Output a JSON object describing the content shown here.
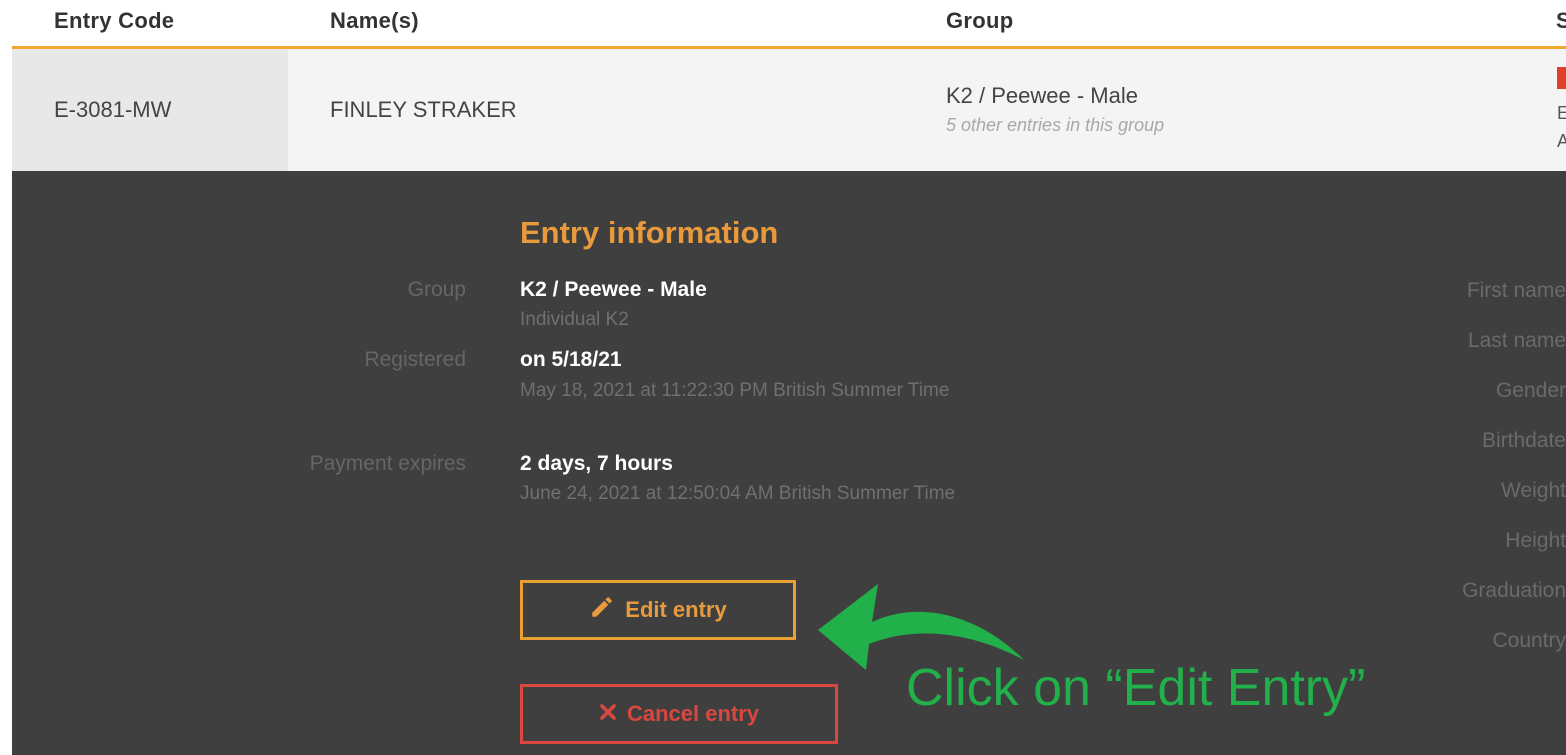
{
  "table": {
    "headers": [
      "Entry Code",
      "Name(s)",
      "Group",
      "S"
    ],
    "row": {
      "code": "E-3081-MW",
      "names": "FINLEY STRAKER",
      "group": "K2 / Peewee - Male",
      "group_note": "5 other entries in this group",
      "status_fragments": [
        "E",
        "A"
      ],
      "status_color": "#e0402a"
    }
  },
  "panel": {
    "title": "Entry information",
    "fields": [
      {
        "label": "Group",
        "value": "K2 / Peewee - Male",
        "detail": "Individual K2"
      },
      {
        "label": "Registered",
        "value": "on 5/18/21",
        "detail": "May 18, 2021 at 11:22:30 PM British Summer Time"
      },
      {
        "label": "Payment expires",
        "value": "2 days, 7 hours",
        "detail": "June 24, 2021 at 12:50:04 AM British Summer Time"
      }
    ],
    "right_labels": [
      "First name",
      "Last name",
      "Gender",
      "Birthdate",
      "Weight",
      "Height",
      "Graduation",
      "Country"
    ],
    "edit_button": "Edit entry",
    "cancel_button": "Cancel entry"
  },
  "annotation": {
    "text": "Click on “Edit Entry”",
    "color": "#22b04a"
  },
  "colors": {
    "accent": "#e89a3c",
    "danger": "#d9473e",
    "panel_bg": "#3f3f3f"
  }
}
